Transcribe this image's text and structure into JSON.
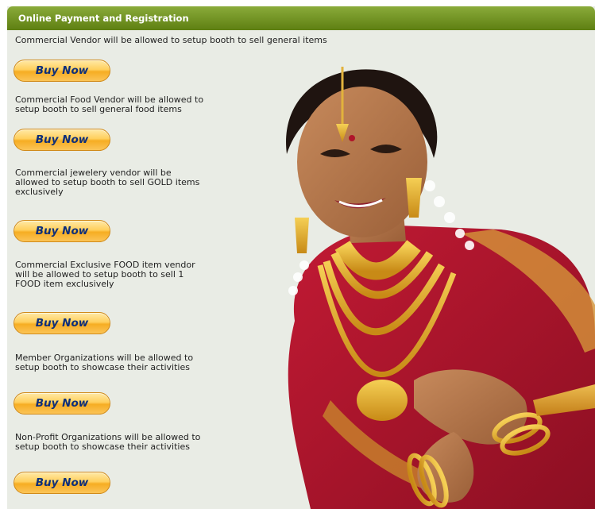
{
  "panel": {
    "title": "Online Payment and Registration"
  },
  "offers": [
    {
      "description": "Commercial Vendor will be allowed to setup booth to sell general items",
      "button_label": "Buy Now"
    },
    {
      "description": "Commercial Food Vendor will be allowed to\nsetup booth to sell general food items",
      "button_label": "Buy Now"
    },
    {
      "description": "Commercial jewelery vendor will be\nallowed to setup booth to sell GOLD items\nexclusively",
      "button_label": "Buy Now"
    },
    {
      "description": "Commercial Exclusive FOOD item vendor\nwill be allowed to setup booth to sell 1\nFOOD item exclusively",
      "button_label": "Buy Now"
    },
    {
      "description": "Member Organizations will be allowed to\nsetup booth to showcase their activities",
      "button_label": "Buy Now"
    },
    {
      "description": "Non-Profit Organizations will be allowed to\nsetup booth to showcase their activities",
      "button_label": "Buy Now"
    }
  ],
  "colors": {
    "header_bg": "#6b8c1f",
    "panel_bg": "#e9ece5",
    "button_text": "#0e2f7a",
    "button_fill": "#f6ad22"
  },
  "image": {
    "subject": "woman-in-red-saree-with-gold-jewelry"
  }
}
